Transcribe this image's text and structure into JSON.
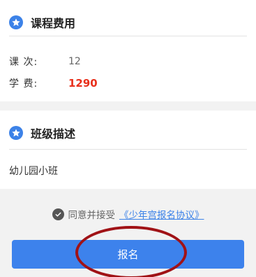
{
  "fee_section": {
    "title": "课程费用",
    "icon": "star-icon",
    "count_label": "课  次:",
    "count_value": "12",
    "fee_label": "学  费:",
    "fee_value": "1290"
  },
  "desc_section": {
    "title": "班级描述",
    "icon": "star-icon",
    "text": "幼儿园小班"
  },
  "agreement": {
    "icon": "check-circle-icon",
    "text": "同意并接受",
    "link": "《少年宫报名协议》"
  },
  "submit": {
    "label": "报名"
  },
  "colors": {
    "accent": "#3c82e8",
    "price": "#e8301c",
    "annotation": "#a01216"
  }
}
